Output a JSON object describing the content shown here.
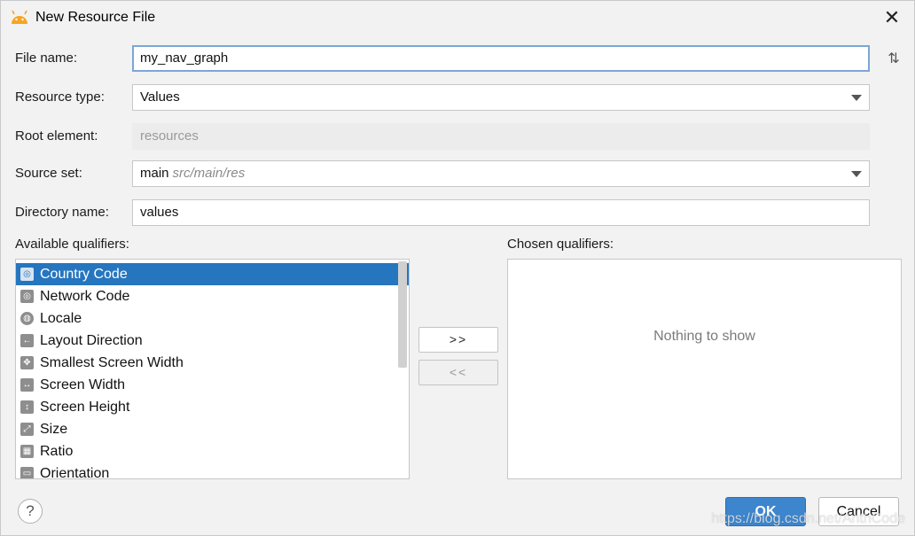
{
  "window": {
    "title": "New Resource File",
    "app_icon": "android-icon",
    "close_icon": "close-icon"
  },
  "form": {
    "file_name_label": "File name:",
    "file_name_value": "my_nav_graph",
    "resource_type_label": "Resource type:",
    "resource_type_value": "Values",
    "root_element_label": "Root element:",
    "root_element_value": "resources",
    "source_set_label": "Source set:",
    "source_set_value": "main",
    "source_set_path": "src/main/res",
    "directory_label": "Directory name:",
    "directory_value": "values"
  },
  "qualifiers": {
    "available_label": "Available qualifiers:",
    "chosen_label": "Chosen qualifiers:",
    "items": [
      {
        "label": "Country Code",
        "icon": "country-code-icon"
      },
      {
        "label": "Network Code",
        "icon": "network-code-icon"
      },
      {
        "label": "Locale",
        "icon": "globe-icon"
      },
      {
        "label": "Layout Direction",
        "icon": "layout-direction-icon"
      },
      {
        "label": "Smallest Screen Width",
        "icon": "smallest-width-icon"
      },
      {
        "label": "Screen Width",
        "icon": "screen-width-icon"
      },
      {
        "label": "Screen Height",
        "icon": "screen-height-icon"
      },
      {
        "label": "Size",
        "icon": "size-icon"
      },
      {
        "label": "Ratio",
        "icon": "ratio-icon"
      },
      {
        "label": "Orientation",
        "icon": "orientation-icon"
      }
    ],
    "add_button": ">>",
    "remove_button": "<<",
    "empty_text": "Nothing to show"
  },
  "buttons": {
    "help": "?",
    "ok": "OK",
    "cancel": "Cancel"
  },
  "watermark": "https://blog.csdn.net/AnthCode",
  "colors": {
    "selection": "#2675bf",
    "ok_button": "#3d85cc",
    "focus_border": "#7ba6d6"
  }
}
